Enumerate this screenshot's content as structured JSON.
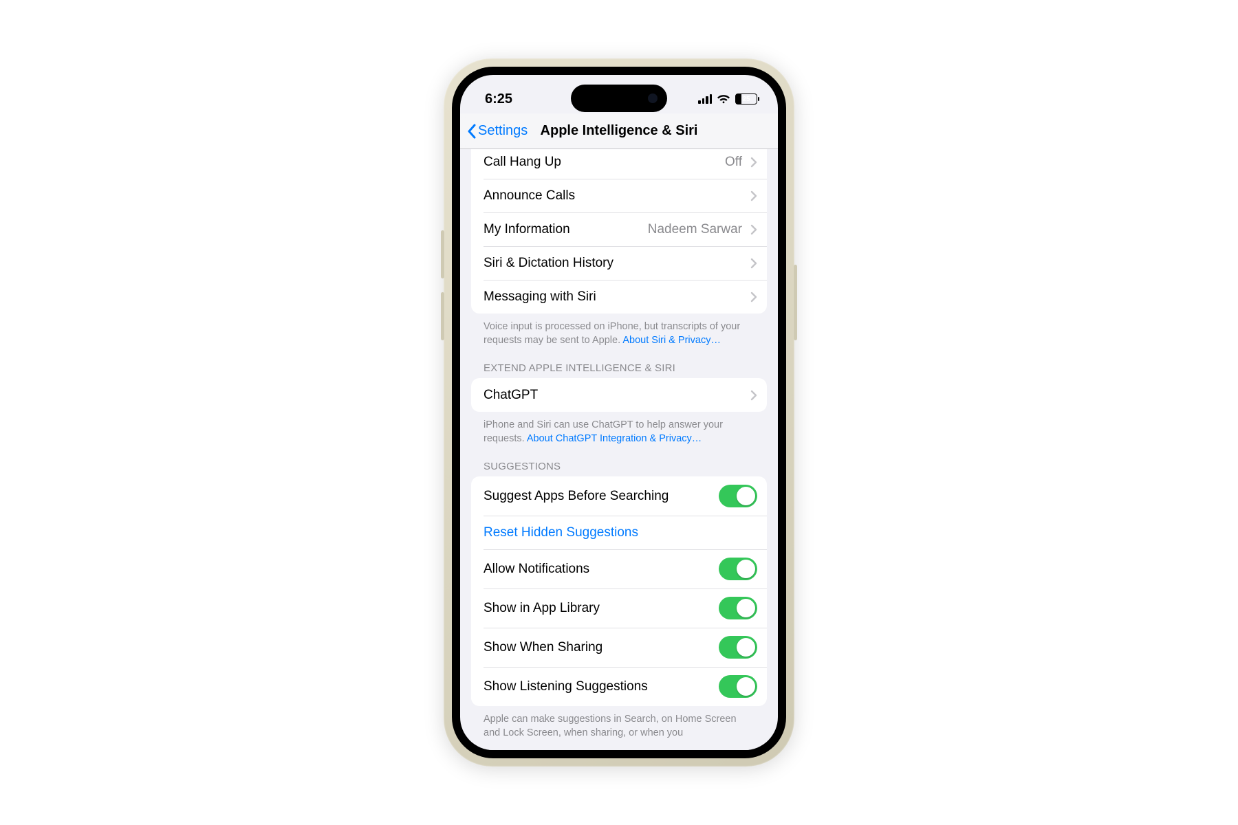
{
  "status": {
    "time": "6:25",
    "battery_pct": "25"
  },
  "nav": {
    "back_label": "Settings",
    "title": "Apple Intelligence & Siri"
  },
  "group1": {
    "items": [
      {
        "label": "Call Hang Up",
        "value": "Off"
      },
      {
        "label": "Announce Calls",
        "value": ""
      },
      {
        "label": "My Information",
        "value": "Nadeem Sarwar"
      },
      {
        "label": "Siri & Dictation History",
        "value": ""
      },
      {
        "label": "Messaging with Siri",
        "value": ""
      }
    ],
    "footer_text": "Voice input is processed on iPhone, but transcripts of your requests may be sent to Apple. ",
    "footer_link": "About Siri & Privacy…"
  },
  "group2": {
    "header": "Extend Apple Intelligence & Siri",
    "item": {
      "label": "ChatGPT"
    },
    "footer_text": "iPhone and Siri can use ChatGPT to help answer your requests. ",
    "footer_link": "About ChatGPT Integration & Privacy…"
  },
  "group3": {
    "header": "Suggestions",
    "rows": {
      "suggest_apps": "Suggest Apps Before Searching",
      "reset_hidden": "Reset Hidden Suggestions",
      "allow_notifications": "Allow Notifications",
      "show_app_library": "Show in App Library",
      "show_when_sharing": "Show When Sharing",
      "show_listening": "Show Listening Suggestions"
    },
    "footer_text": "Apple can make suggestions in Search, on Home Screen and Lock Screen, when sharing, or when you"
  }
}
